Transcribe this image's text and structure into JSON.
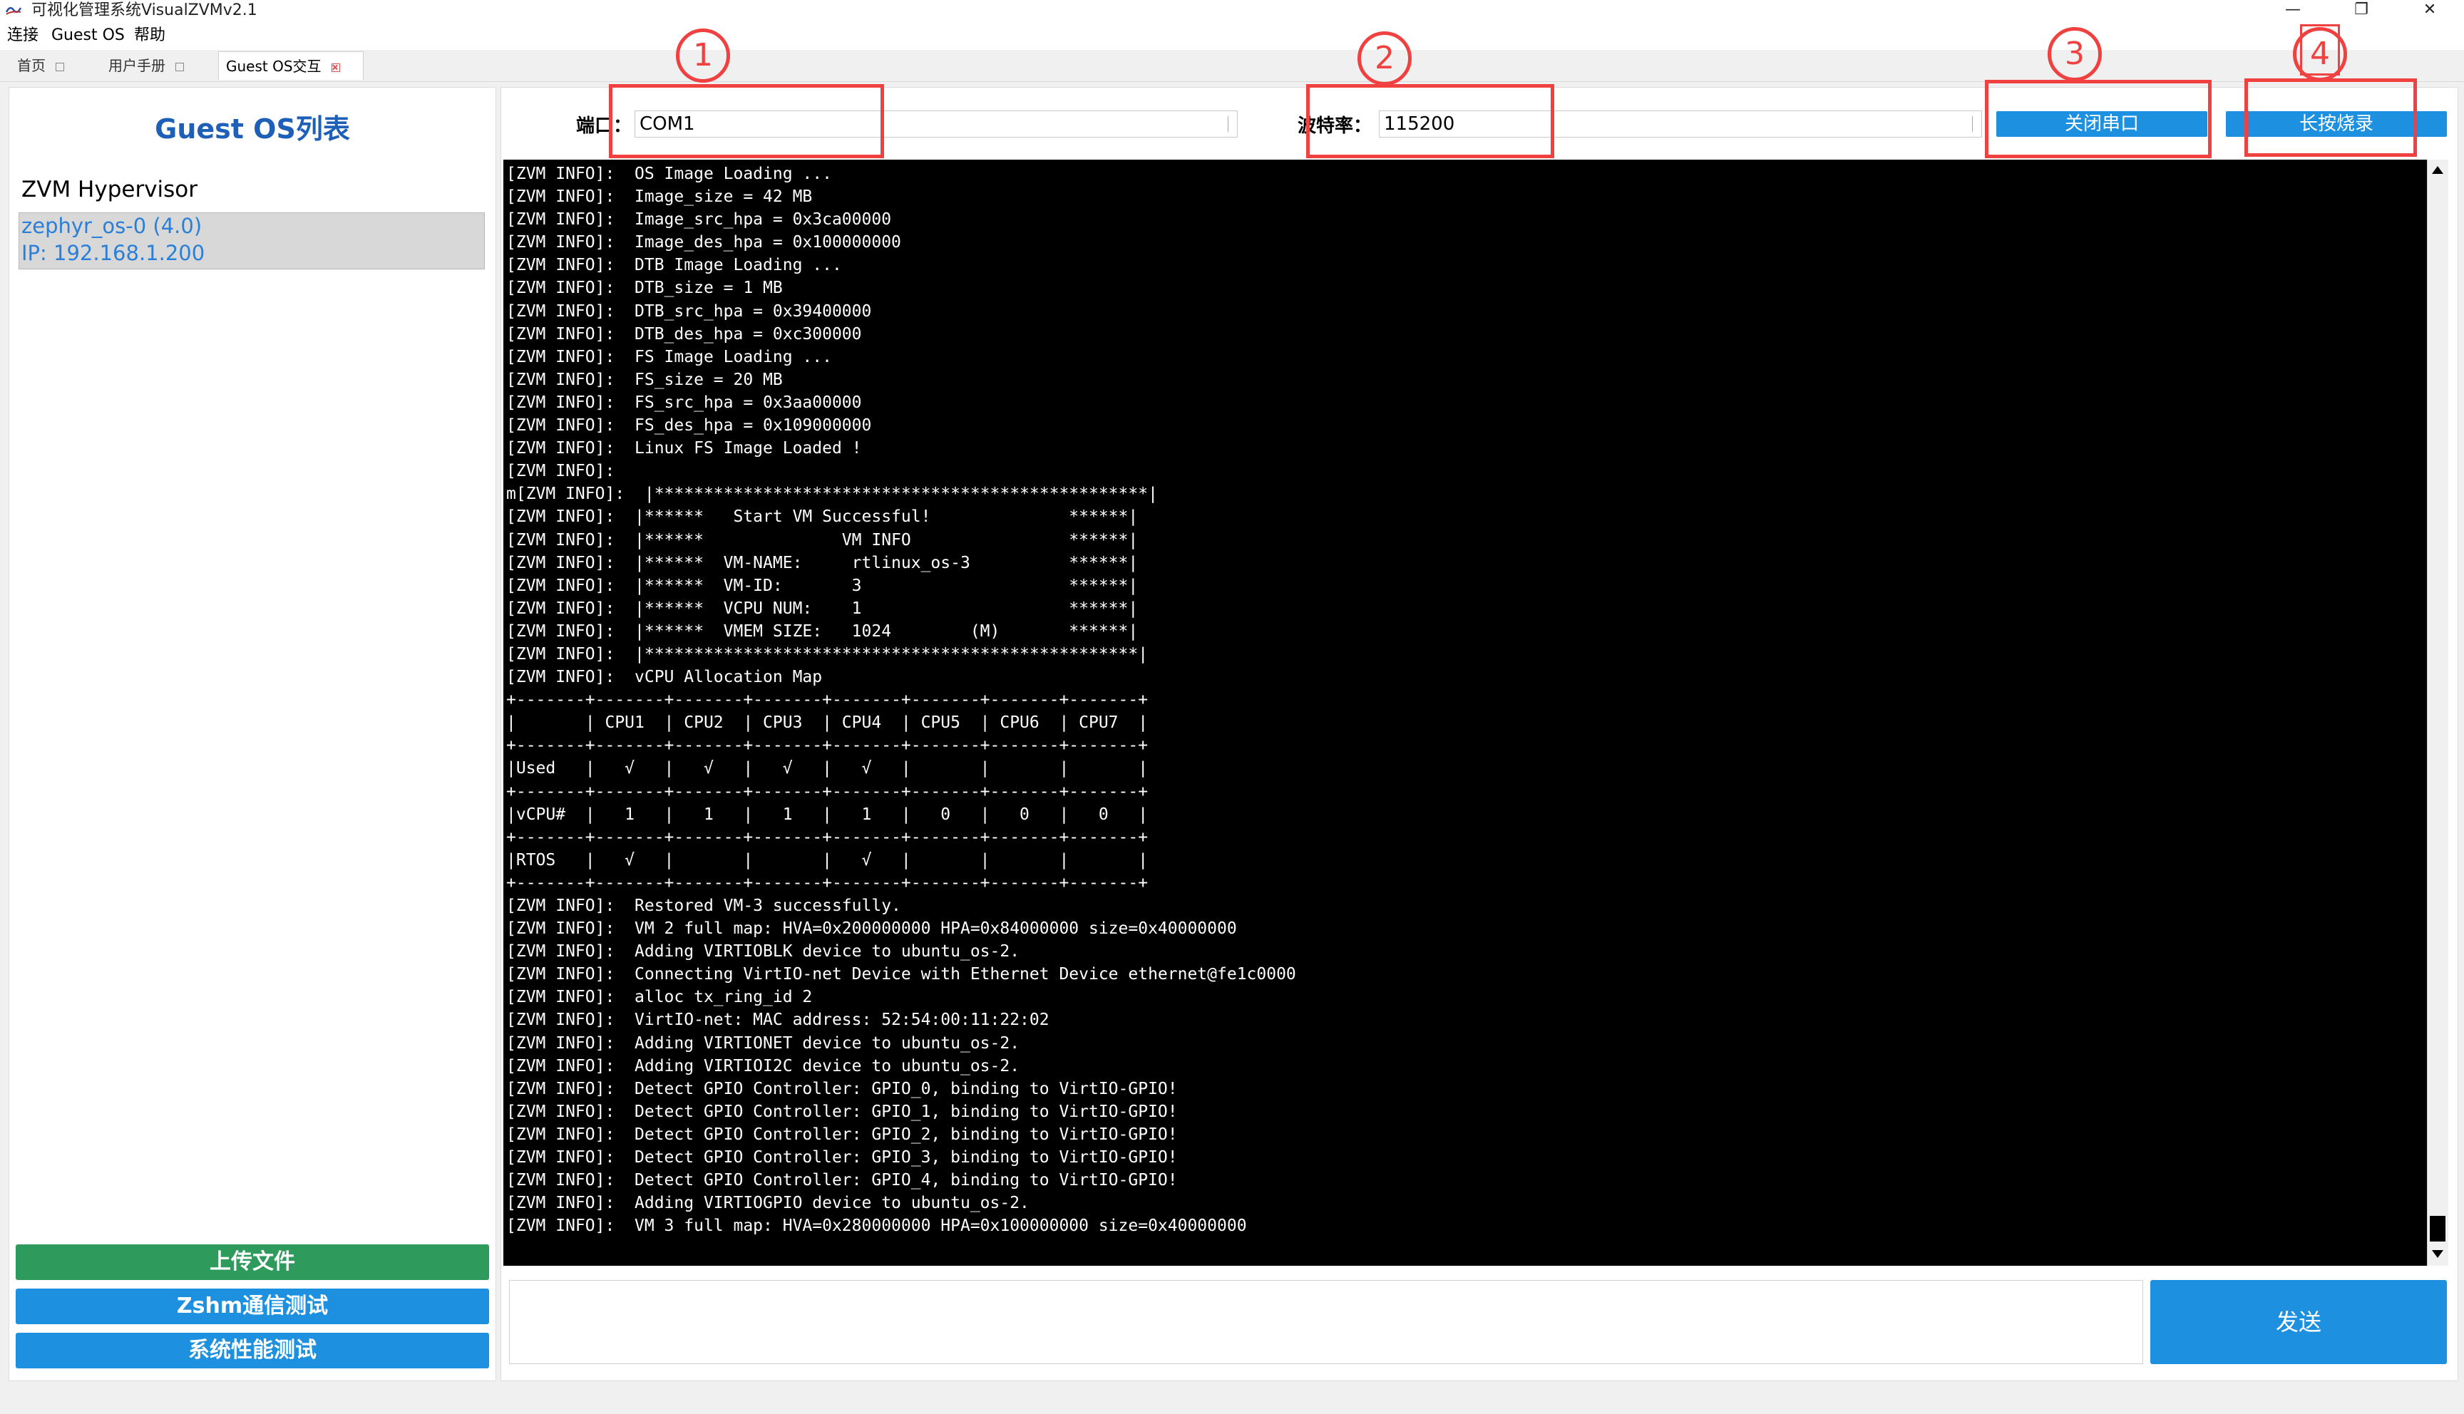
{
  "window": {
    "title": "可视化管理系统VisualZVMv2.1",
    "controls": [
      "—",
      "❐",
      "✕"
    ]
  },
  "menu": [
    "连接",
    "Guest OS",
    "帮助"
  ],
  "tabs": [
    {
      "label": "首页",
      "active": false
    },
    {
      "label": "用户手册",
      "active": false
    },
    {
      "label": "Guest OS交互",
      "active": true
    }
  ],
  "sidebar": {
    "title": "Guest OS列表",
    "tree_root": "ZVM Hypervisor",
    "node_lines": [
      "zephyr_os-0 (4.0)",
      "IP: 192.168.1.200"
    ],
    "buttons": [
      "上传文件",
      "Zshm通信测试",
      "系统性能测试"
    ]
  },
  "serial": {
    "port_label": "端口：",
    "port_value": "COM1",
    "baud_label": "波特率：",
    "baud_value": "115200",
    "close_button": "关闭串口",
    "flash_button": "长按烧录"
  },
  "console_lines": [
    "[ZVM INFO]:  OS Image Loading ...",
    "[ZVM INFO]:  Image_size = 42 MB",
    "[ZVM INFO]:  Image_src_hpa = 0x3ca00000",
    "[ZVM INFO]:  Image_des_hpa = 0x100000000",
    "[ZVM INFO]:  DTB Image Loading ...",
    "[ZVM INFO]:  DTB_size = 1 MB",
    "[ZVM INFO]:  DTB_src_hpa = 0x39400000",
    "[ZVM INFO]:  DTB_des_hpa = 0xc300000",
    "[ZVM INFO]:  FS Image Loading ...",
    "[ZVM INFO]:  FS_size = 20 MB",
    "[ZVM INFO]:  FS_src_hpa = 0x3aa00000",
    "[ZVM INFO]:  FS_des_hpa = 0x109000000",
    "[ZVM INFO]:  Linux FS Image Loaded !",
    "[ZVM INFO]:",
    "m[ZVM INFO]:  |**************************************************|",
    "[ZVM INFO]:  |******   Start VM Successful!              ******|",
    "[ZVM INFO]:  |******              VM INFO                ******|",
    "[ZVM INFO]:  |******  VM-NAME:     rtlinux_os-3          ******|",
    "[ZVM INFO]:  |******  VM-ID:       3                     ******|",
    "[ZVM INFO]:  |******  VCPU NUM:    1                     ******|",
    "[ZVM INFO]:  |******  VMEM SIZE:   1024        (M)       ******|",
    "[ZVM INFO]:  |**************************************************|",
    "[ZVM INFO]:  vCPU Allocation Map",
    "+-------+-------+-------+-------+-------+-------+-------+-------+",
    "|       | CPU1  | CPU2  | CPU3  | CPU4  | CPU5  | CPU6  | CPU7  |",
    "+-------+-------+-------+-------+-------+-------+-------+-------+",
    "|Used   |   √   |   √   |   √   |   √   |       |       |       |",
    "+-------+-------+-------+-------+-------+-------+-------+-------+",
    "|vCPU#  |   1   |   1   |   1   |   1   |   0   |   0   |   0   |",
    "+-------+-------+-------+-------+-------+-------+-------+-------+",
    "|RTOS   |   √   |       |       |   √   |       |       |       |",
    "+-------+-------+-------+-------+-------+-------+-------+-------+",
    "[ZVM INFO]:  Restored VM-3 successfully.",
    "[ZVM INFO]:  VM 2 full map: HVA=0x200000000 HPA=0x84000000 size=0x40000000",
    "[ZVM INFO]:  Adding VIRTIOBLK device to ubuntu_os-2.",
    "[ZVM INFO]:  Connecting VirtIO-net Device with Ethernet Device ethernet@fe1c0000",
    "[ZVM INFO]:  alloc tx_ring_id 2",
    "[ZVM INFO]:  VirtIO-net: MAC address: 52:54:00:11:22:02",
    "[ZVM INFO]:  Adding VIRTIONET device to ubuntu_os-2.",
    "[ZVM INFO]:  Adding VIRTIOI2C device to ubuntu_os-2.",
    "[ZVM INFO]:  Detect GPIO Controller: GPIO_0, binding to VirtIO-GPIO!",
    "[ZVM INFO]:  Detect GPIO Controller: GPIO_1, binding to VirtIO-GPIO!",
    "[ZVM INFO]:  Detect GPIO Controller: GPIO_2, binding to VirtIO-GPIO!",
    "[ZVM INFO]:  Detect GPIO Controller: GPIO_3, binding to VirtIO-GPIO!",
    "[ZVM INFO]:  Detect GPIO Controller: GPIO_4, binding to VirtIO-GPIO!",
    "[ZVM INFO]:  Adding VIRTIOGPIO device to ubuntu_os-2.",
    "[ZVM INFO]:  VM 3 full map: HVA=0x280000000 HPA=0x100000000 size=0x40000000"
  ],
  "send_input_value": "",
  "send_button": "发送",
  "annotations": [
    "1",
    "2",
    "3",
    "4"
  ],
  "colors": {
    "accent_blue": "#1e90e0",
    "upload_green": "#2e9a5c",
    "title_blue": "#1e5fb8",
    "annotation_red": "#f04040",
    "console_bg": "#000000"
  }
}
